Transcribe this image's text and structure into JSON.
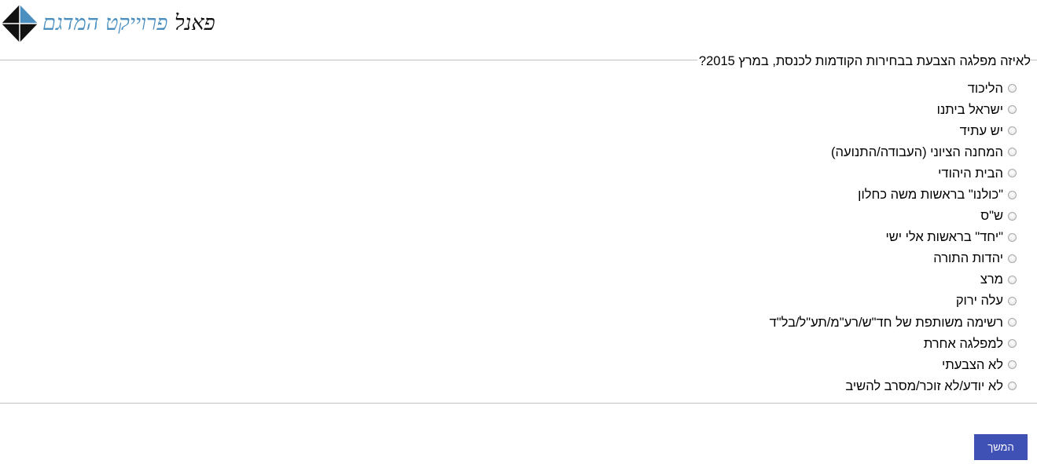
{
  "header": {
    "logo_alt": "panel hamidgam logo",
    "brand_word_1": "פאנל",
    "brand_word_2": "פרוייקט המדגם",
    "colors": {
      "logo_dark": "#111111",
      "logo_blue": "#4a8fc0"
    }
  },
  "survey": {
    "question": "לאיזה מפלגה הצבעת בבחירות הקודמות לכנסת, במרץ 2015?",
    "options": [
      {
        "label": "הליכוד"
      },
      {
        "label": "ישראל ביתנו"
      },
      {
        "label": "יש עתיד"
      },
      {
        "label": "המחנה הציוני (העבודה/התנועה)"
      },
      {
        "label": "הבית היהודי"
      },
      {
        "label": "\"כולנו\" בראשות משה כחלון"
      },
      {
        "label": "ש\"ס"
      },
      {
        "label": "\"יחד\" בראשות אלי ישי"
      },
      {
        "label": "יהדות התורה"
      },
      {
        "label": "מרצ"
      },
      {
        "label": "עלה ירוק"
      },
      {
        "label": "רשימה משותפת של חד\"ש/רע\"מ/תע\"ל/בל\"ד"
      },
      {
        "label": "למפלגה אחרת"
      },
      {
        "label": "לא הצבעתי"
      },
      {
        "label": "לא יודע/לא זוכר/מסרב להשיב"
      }
    ]
  },
  "footer": {
    "continue_label": "המשך",
    "colors": {
      "button_bg": "#3f51b5",
      "button_text": "#ffffff"
    }
  }
}
